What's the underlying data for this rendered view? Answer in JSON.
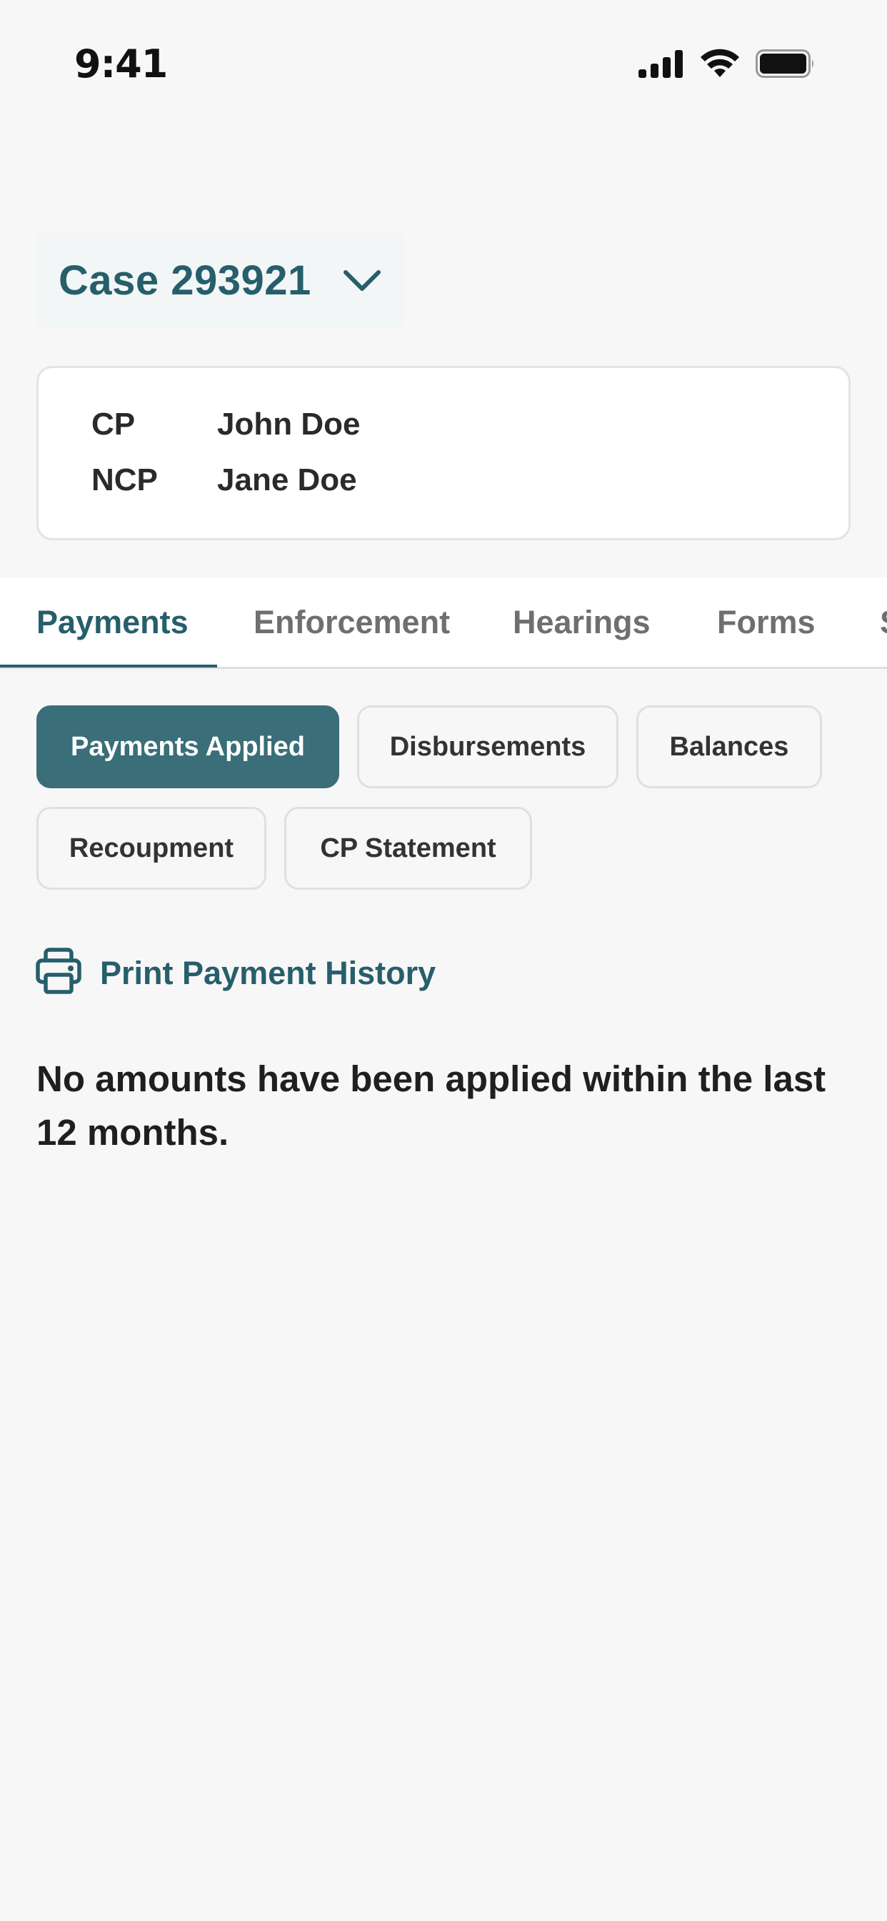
{
  "status_bar": {
    "time": "9:41"
  },
  "case": {
    "title": "Case 293921"
  },
  "parties": [
    {
      "role": "CP",
      "name": "John Doe"
    },
    {
      "role": "NCP",
      "name": "Jane Doe"
    }
  ],
  "tabs": [
    {
      "label": "Payments",
      "active": true
    },
    {
      "label": "Enforcement",
      "active": false
    },
    {
      "label": "Hearings",
      "active": false
    },
    {
      "label": "Forms",
      "active": false
    },
    {
      "label": "S",
      "active": false
    }
  ],
  "filters": [
    {
      "label": "Payments Applied",
      "active": true
    },
    {
      "label": "Disbursements",
      "active": false
    },
    {
      "label": "Balances",
      "active": false
    },
    {
      "label": "Recoupment",
      "active": false
    },
    {
      "label": "CP Statement",
      "active": false
    }
  ],
  "print_link": {
    "label": "Print Payment History",
    "icon": "printer-icon"
  },
  "empty_state": {
    "message": "No amounts have been applied within the last 12 months."
  },
  "colors": {
    "accent": "#265f6b",
    "chip_active": "#3a6e79",
    "background": "#f7f7f8"
  }
}
